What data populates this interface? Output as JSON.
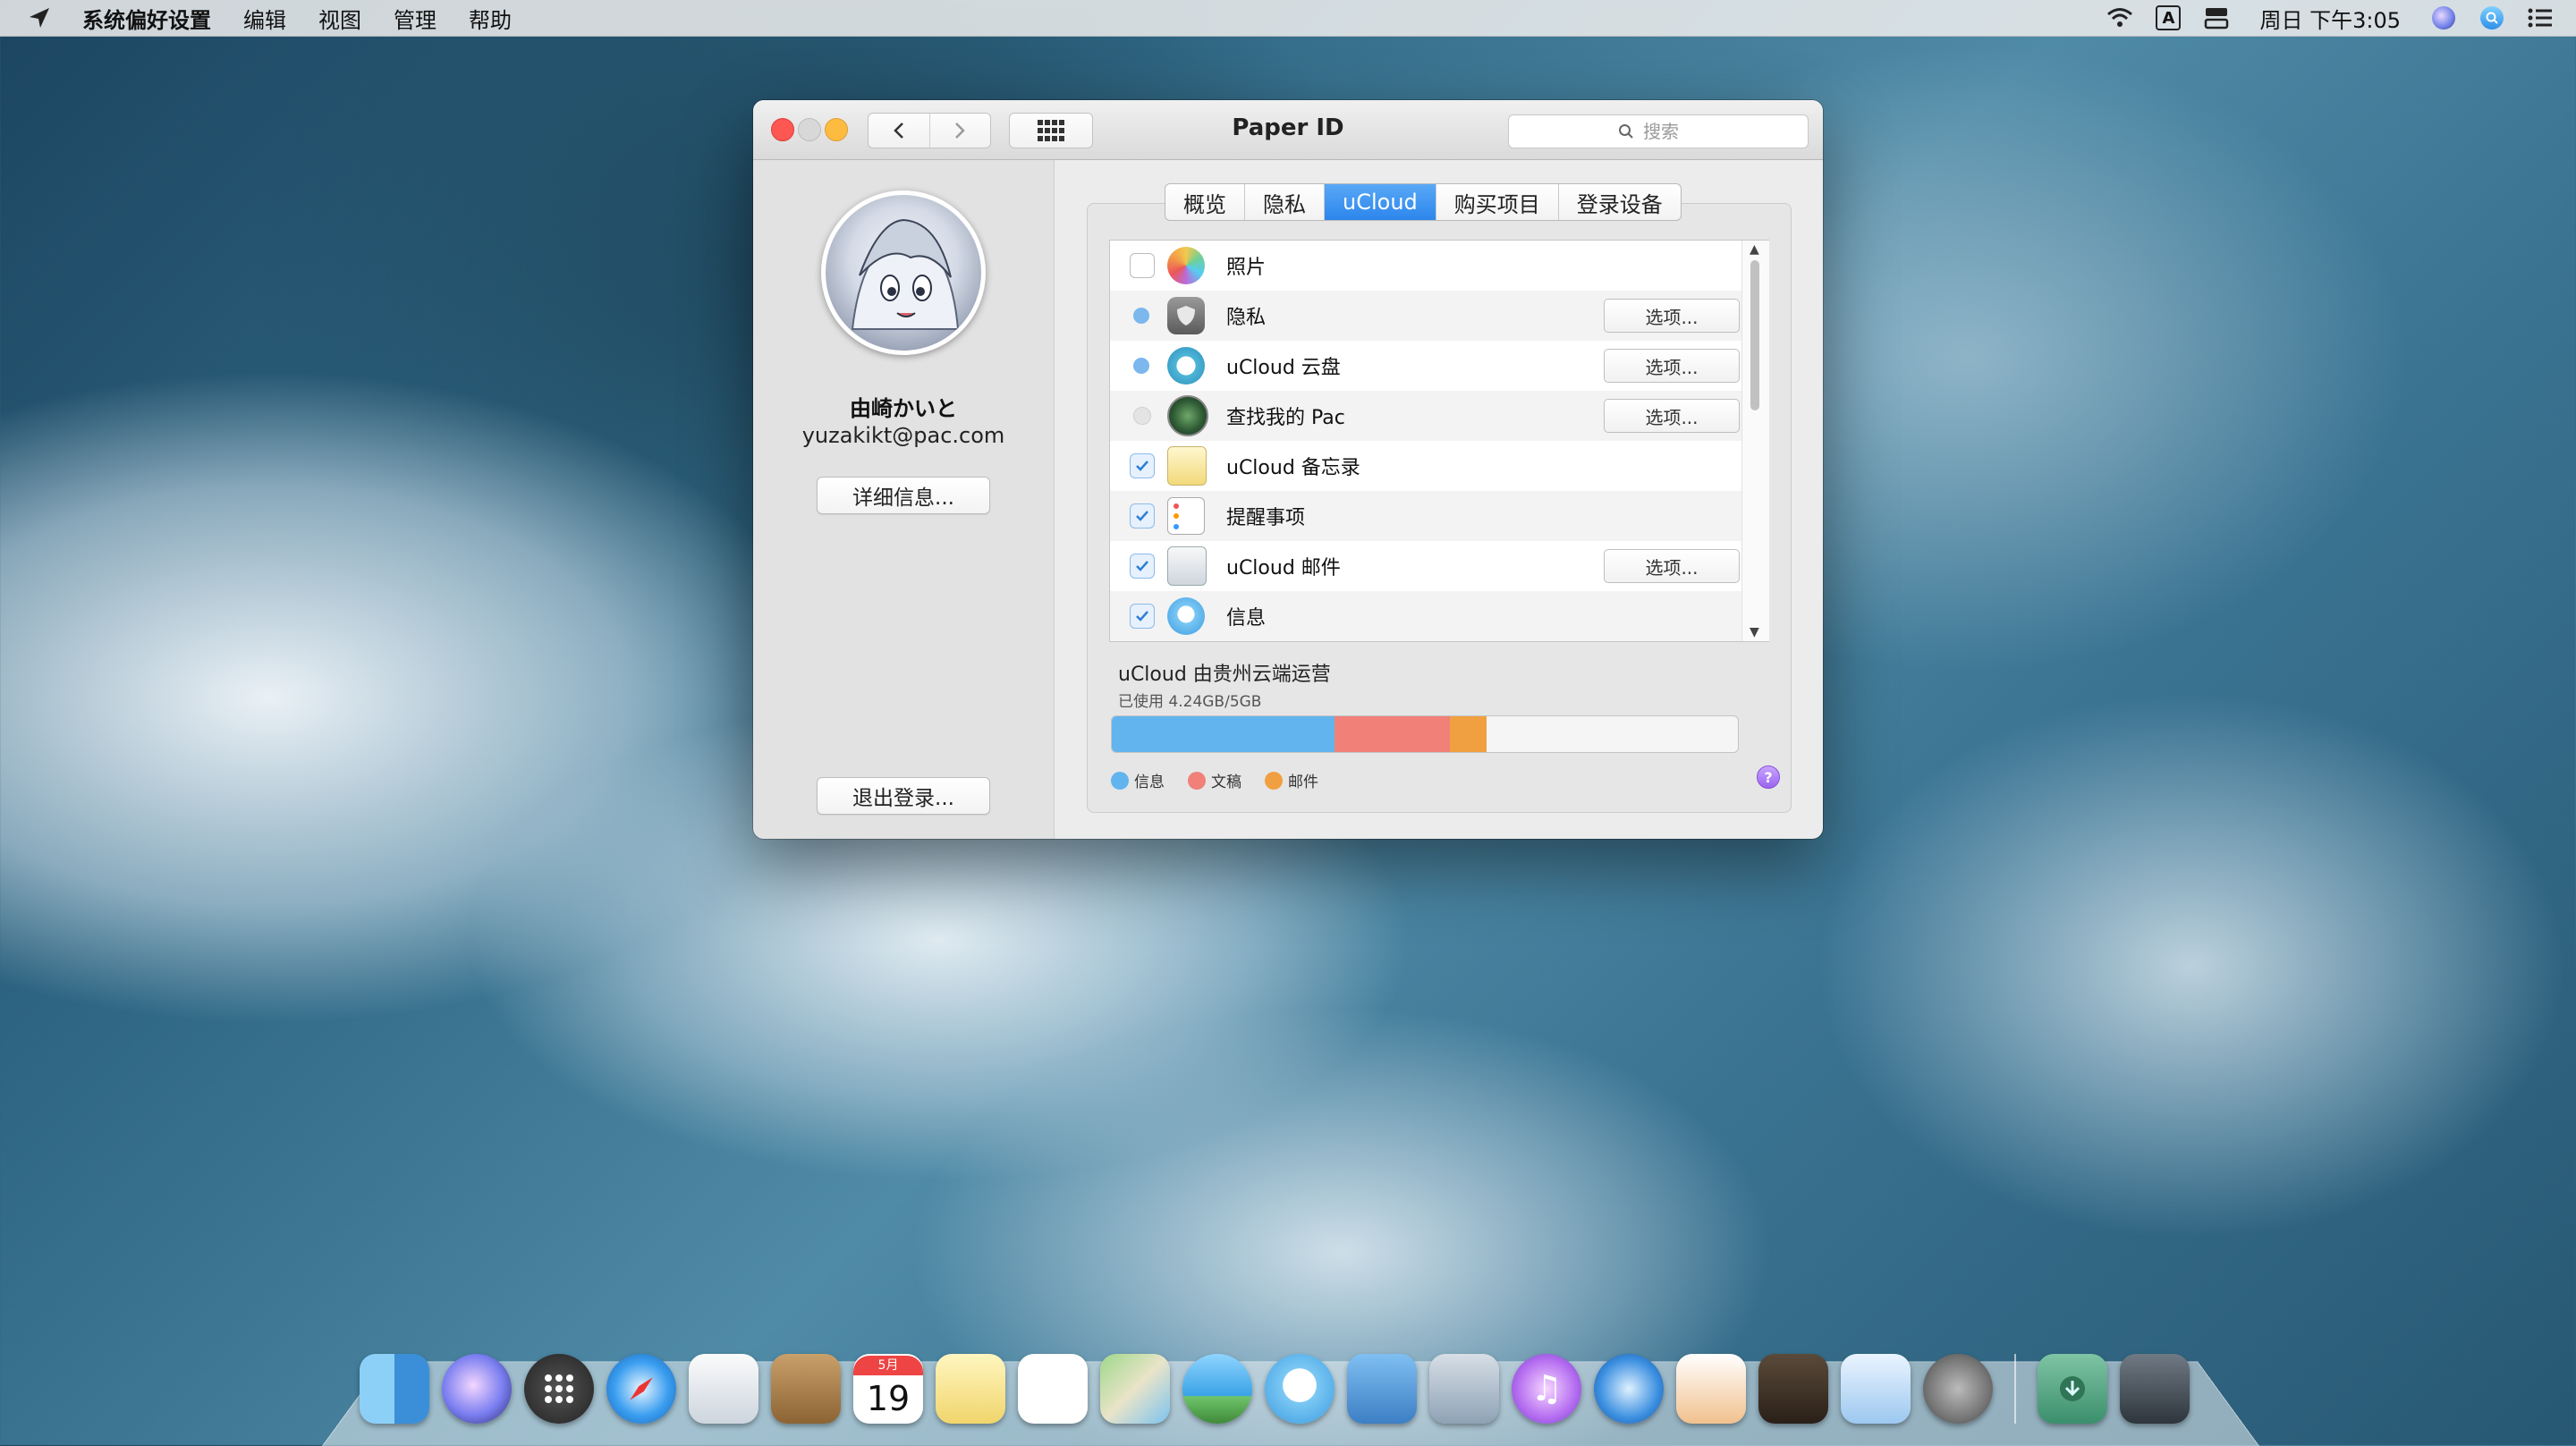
{
  "menubar": {
    "app_name": "系统偏好设置",
    "menus": [
      "编辑",
      "视图",
      "管理",
      "帮助"
    ],
    "clock": "周日 下午3:05"
  },
  "window": {
    "title": "Paper ID",
    "search_placeholder": "搜索"
  },
  "account": {
    "name": "由崎かいと",
    "email": "yuzakikt@pac.com",
    "details_button": "详细信息...",
    "signout_button": "退出登录..."
  },
  "tabs": [
    {
      "label": "概览",
      "active": false
    },
    {
      "label": "隐私",
      "active": false
    },
    {
      "label": "uCloud",
      "active": true
    },
    {
      "label": "购买项目",
      "active": false
    },
    {
      "label": "登录设备",
      "active": false
    }
  ],
  "services": [
    {
      "label": "照片",
      "state": "unchecked",
      "icon": "photos-icon",
      "has_options": false
    },
    {
      "label": "隐私",
      "state": "partial",
      "icon": "privacy-icon",
      "has_options": true
    },
    {
      "label": "uCloud 云盘",
      "state": "partial",
      "icon": "ucloud-drive-icon",
      "has_options": true
    },
    {
      "label": "查找我的 Pac",
      "state": "disabled",
      "icon": "find-my-pac-icon",
      "has_options": true
    },
    {
      "label": "uCloud 备忘录",
      "state": "checked",
      "icon": "notes-icon",
      "has_options": false
    },
    {
      "label": "提醒事项",
      "state": "checked",
      "icon": "reminders-icon",
      "has_options": false
    },
    {
      "label": "uCloud 邮件",
      "state": "checked",
      "icon": "mail-icon",
      "has_options": true
    },
    {
      "label": "信息",
      "state": "checked",
      "icon": "messages-icon",
      "has_options": false
    }
  ],
  "options_label": "选项...",
  "storage": {
    "title": "uCloud 由贵州云端运营",
    "used_text": "已使用 4.24GB/5GB",
    "segments": [
      {
        "name": "信息",
        "fraction": 0.355,
        "color": "#62b4ee"
      },
      {
        "name": "文稿",
        "fraction": 0.185,
        "color": "#f08078"
      },
      {
        "name": "邮件",
        "fraction": 0.058,
        "color": "#f0a040"
      }
    ]
  },
  "dock": [
    "finder-icon",
    "siri-icon",
    "launchpad-icon",
    "safari-icon",
    "mail-icon",
    "contacts-icon",
    "calendar-icon",
    "notes-icon",
    "reminders-icon",
    "maps-icon",
    "photos-icon",
    "messages-icon",
    "facetime-icon",
    "image-capture-icon",
    "music-icon",
    "books-icon",
    "pages-icon",
    "keynote-icon",
    "preview-icon",
    "system-preferences-icon",
    "downloads-folder-icon",
    "trash-icon"
  ],
  "calendar": {
    "month": "5月",
    "day": "19"
  }
}
